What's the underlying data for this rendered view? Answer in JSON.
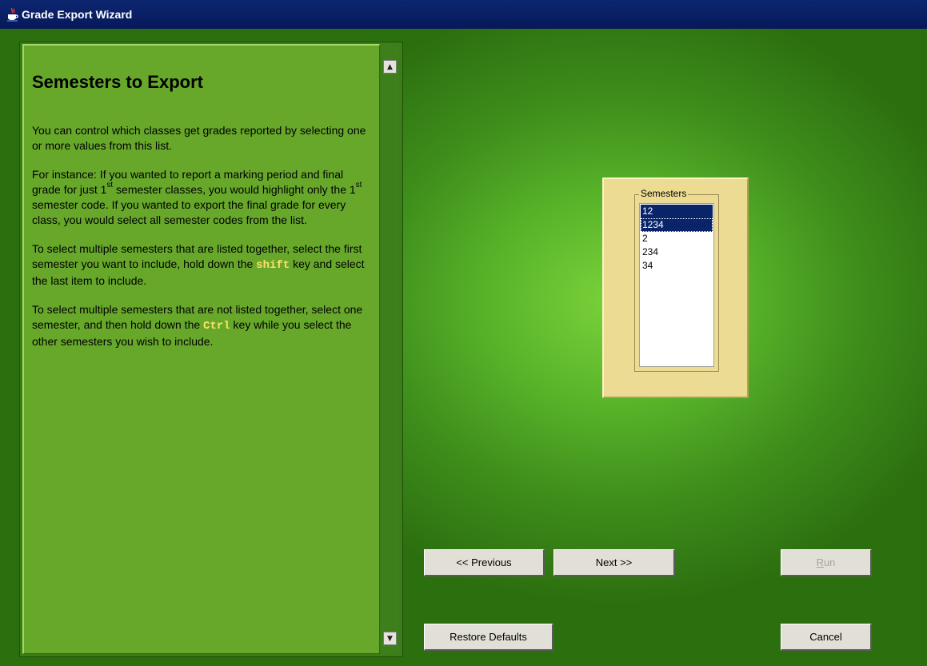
{
  "window": {
    "title": "Grade Export Wizard",
    "icon": "java-cup-icon"
  },
  "help": {
    "title": "Semesters to Export",
    "p1": "You can control which classes get grades reported by selecting one or more values from this list.",
    "p2_a": "For instance: If you wanted to report a marking period and final grade for just 1",
    "p2_sup1": "st",
    "p2_b": " semester classes, you would highlight only the 1",
    "p2_sup2": "st",
    "p2_c": " semester code. If you wanted to export the final grade for every class, you would select all semester codes from the list.",
    "p3_a": "To select multiple semesters that are listed together, select the first semester you want to include, hold down the ",
    "p3_key": "shift",
    "p3_b": " key and select the last item to include.",
    "p4_a": "To select multiple semesters that are not listed together, select one semester, and then hold down the ",
    "p4_key": "Ctrl",
    "p4_b": " key while you select the other semesters you wish to include."
  },
  "semesters": {
    "label": "Semesters",
    "items": [
      {
        "label": "12"
      },
      {
        "label": "1234"
      },
      {
        "label": "2"
      },
      {
        "label": "234"
      },
      {
        "label": "34"
      }
    ]
  },
  "buttons": {
    "previous": "<< Previous",
    "next": "Next >>",
    "run_mnemonic": "R",
    "run_rest": "un",
    "restore": "Restore Defaults",
    "cancel": "Cancel"
  },
  "colors": {
    "background": "#58b329",
    "help_panel": "#67a82b",
    "list_panel": "#ecdc93",
    "selection": "#0a246a",
    "key_highlight": "#ffe06a"
  }
}
